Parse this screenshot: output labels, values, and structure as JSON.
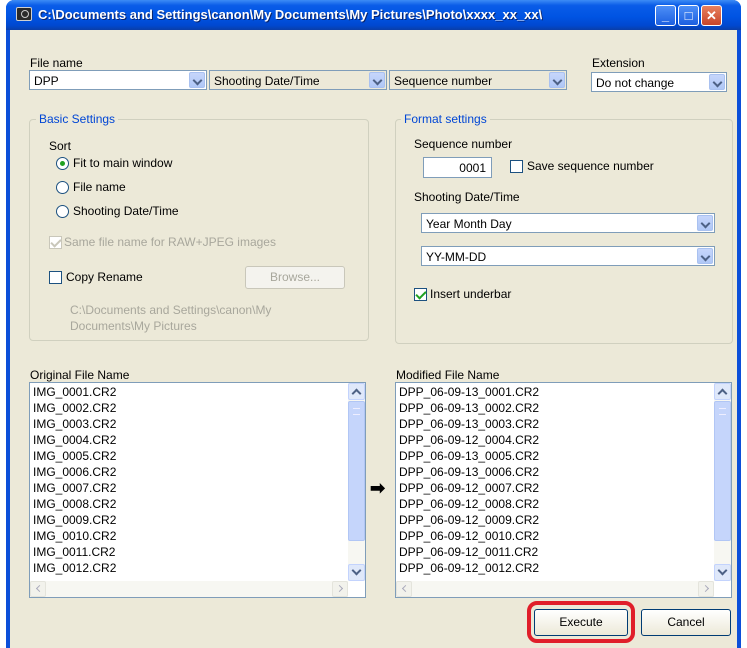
{
  "window": {
    "title": "C:\\Documents and Settings\\canon\\My Documents\\My Pictures\\Photo\\xxxx_xx_xx\\"
  },
  "file_name": {
    "label": "File name",
    "field1": "DPP",
    "field2": "Shooting Date/Time",
    "field3": "Sequence number"
  },
  "extension": {
    "label": "Extension",
    "value": "Do not change"
  },
  "basic_settings": {
    "title": "Basic Settings",
    "sort_label": "Sort",
    "sort_options": [
      "Fit to main window",
      "File name",
      "Shooting Date/Time"
    ],
    "sort_selected": "Fit to main window",
    "same_name_label": "Same file name for RAW+JPEG images",
    "same_name_checked": true,
    "copy_rename_label": "Copy Rename",
    "copy_rename_checked": false,
    "browse_label": "Browse...",
    "path": "C:\\Documents and Settings\\canon\\My Documents\\My Pictures"
  },
  "format_settings": {
    "title": "Format settings",
    "sequence_label": "Sequence number",
    "sequence_value": "0001",
    "save_sequence_label": "Save sequence number",
    "save_sequence_checked": false,
    "shooting_label": "Shooting Date/Time",
    "date_order": "Year Month Day",
    "date_format": "YY-MM-DD",
    "insert_underbar_label": "Insert underbar",
    "insert_underbar_checked": true
  },
  "original": {
    "label": "Original File Name",
    "items": [
      "IMG_0001.CR2",
      "IMG_0002.CR2",
      "IMG_0003.CR2",
      "IMG_0004.CR2",
      "IMG_0005.CR2",
      "IMG_0006.CR2",
      "IMG_0007.CR2",
      "IMG_0008.CR2",
      "IMG_0009.CR2",
      "IMG_0010.CR2",
      "IMG_0011.CR2",
      "IMG_0012.CR2"
    ]
  },
  "modified": {
    "label": "Modified File Name",
    "items": [
      "DPP_06-09-13_0001.CR2",
      "DPP_06-09-13_0002.CR2",
      "DPP_06-09-13_0003.CR2",
      "DPP_06-09-12_0004.CR2",
      "DPP_06-09-13_0005.CR2",
      "DPP_06-09-13_0006.CR2",
      "DPP_06-09-12_0007.CR2",
      "DPP_06-09-12_0008.CR2",
      "DPP_06-09-12_0009.CR2",
      "DPP_06-09-12_0010.CR2",
      "DPP_06-09-12_0011.CR2",
      "DPP_06-09-12_0012.CR2"
    ]
  },
  "arrow": "➡",
  "buttons": {
    "execute": "Execute",
    "cancel": "Cancel"
  },
  "titlebar_buttons": {
    "minimize": "_",
    "maximize": "□",
    "close": "✕"
  },
  "colors": {
    "highlight": "#e01e2a",
    "titlebar": "#0054e3",
    "group_title": "#0046d5"
  }
}
